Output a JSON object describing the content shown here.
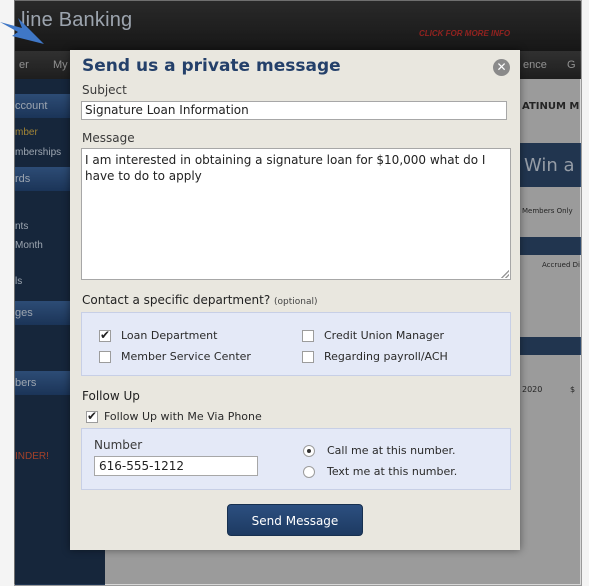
{
  "background": {
    "title": "line Banking",
    "promo": "CLICK FOR MORE INFO",
    "nav": [
      "er",
      "My",
      "ence",
      "G"
    ],
    "sidebar": [
      "ccount",
      "mber",
      "mberships",
      "rds",
      "nts",
      "Month",
      "ls",
      "ges",
      "bers",
      "INDER!"
    ],
    "right_labels": [
      "ATINUM M",
      "Win a",
      "Members Only",
      "Accrued Di",
      "2020",
      "$"
    ]
  },
  "modal": {
    "title": "Send us a private message",
    "close_icon": "close-icon",
    "subject_label": "Subject",
    "subject_value": "Signature Loan Information",
    "message_label": "Message",
    "message_value": "I am interested in obtaining a signature loan for $10,000 what do I have to do to apply",
    "dept_heading": "Contact a specific department?",
    "dept_optional": "(optional)",
    "departments": [
      {
        "label": "Loan Department",
        "checked": true
      },
      {
        "label": "Credit Union Manager",
        "checked": false
      },
      {
        "label": "Member Service Center",
        "checked": false
      },
      {
        "label": "Regarding payroll/ACH",
        "checked": false
      }
    ],
    "followup_heading": "Follow Up",
    "followup_phone_label": "Follow Up with Me Via Phone",
    "followup_phone_checked": true,
    "number_label": "Number",
    "number_value": "616-555-1212",
    "contact_options": [
      {
        "label": "Call me at this number.",
        "selected": true
      },
      {
        "label": "Text me at this number.",
        "selected": false
      }
    ],
    "send_label": "Send Message"
  },
  "colors": {
    "accent": "#24406a",
    "button": "#1d3a62",
    "panel": "#e4e9f7",
    "arrow": "#3f77c6"
  }
}
